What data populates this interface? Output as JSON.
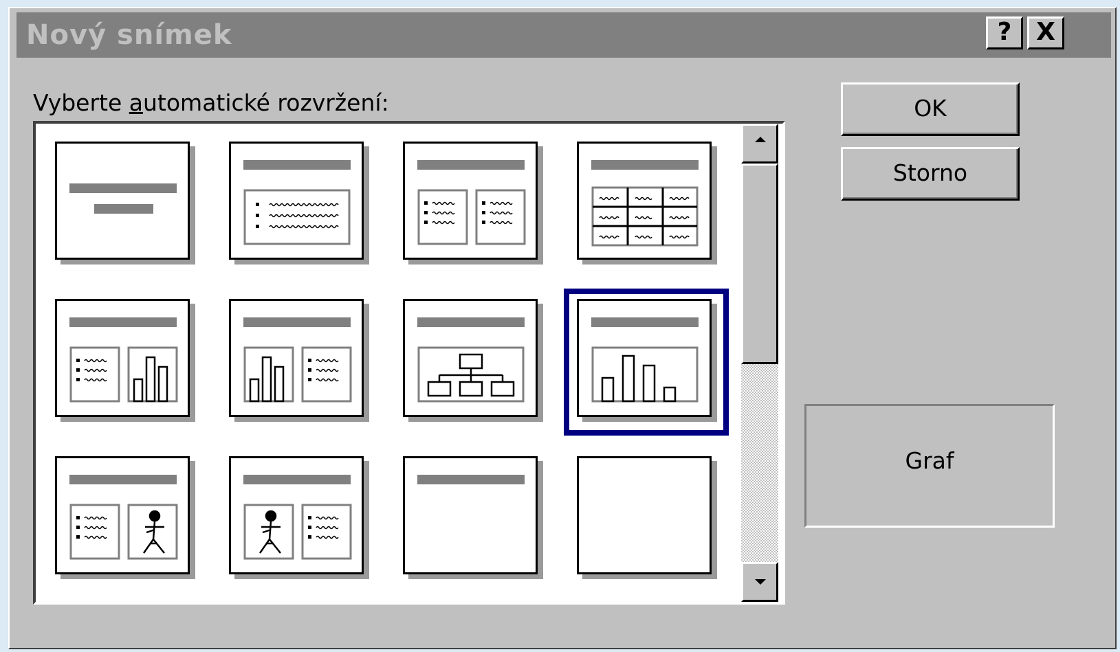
{
  "window": {
    "title": "Nový snímek",
    "help_label": "?",
    "close_label": "X"
  },
  "prompt": {
    "before": "Vyberte ",
    "accel": "a",
    "after": "utomatické rozvržení:"
  },
  "buttons": {
    "ok_label": "OK",
    "cancel_label": "Storno"
  },
  "preview": {
    "label": "Graf"
  },
  "layouts": [
    {
      "id": "title-slide",
      "selected": false
    },
    {
      "id": "bulleted-list",
      "selected": false
    },
    {
      "id": "two-column-text",
      "selected": false
    },
    {
      "id": "table",
      "selected": false
    },
    {
      "id": "text-and-chart",
      "selected": false
    },
    {
      "id": "chart-and-text",
      "selected": false
    },
    {
      "id": "organization-chart",
      "selected": false
    },
    {
      "id": "chart",
      "selected": true
    },
    {
      "id": "text-and-clip-art",
      "selected": false
    },
    {
      "id": "clip-art-and-text",
      "selected": false
    },
    {
      "id": "title-only",
      "selected": false
    },
    {
      "id": "blank",
      "selected": false
    }
  ],
  "colors": {
    "selection": "#000080",
    "face": "#c0c0c0",
    "titlebar_inactive": "#808080"
  }
}
